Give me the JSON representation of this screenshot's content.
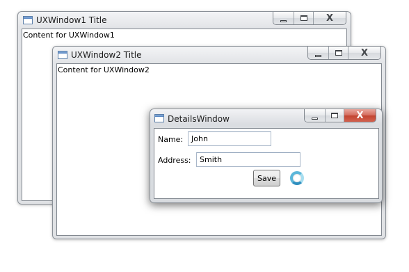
{
  "window1": {
    "title": "UXWindow1 Title",
    "content": "Content for UXWindow1",
    "minimize_glyph": "minimize-icon",
    "maximize_glyph": "maximize-icon",
    "close_glyph": "close-icon"
  },
  "window2": {
    "title": "UXWindow2 Title",
    "content": "Content for UXWindow2"
  },
  "details": {
    "title": "DetailsWindow",
    "name_label": "Name:",
    "name_value": "John",
    "address_label": "Address:",
    "address_value": "Smith",
    "save_label": "Save",
    "busy_indicator": "loading-spinner-icon",
    "close_color": "#c8503d"
  },
  "caption": {
    "close_symbol": "X"
  }
}
